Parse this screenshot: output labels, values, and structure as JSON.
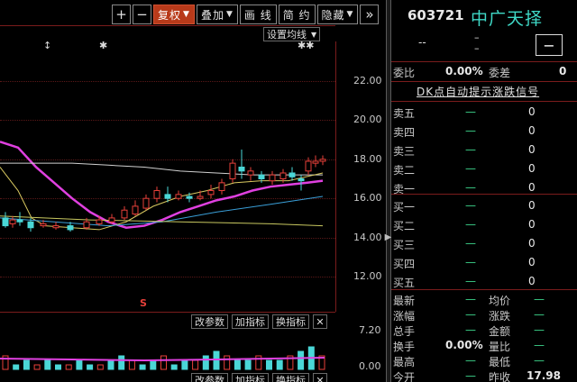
{
  "toolbar": {
    "plus": "+",
    "minus": "−",
    "fuquan": "复权",
    "diejia": "叠加",
    "huaxian": "画 线",
    "jianyue": "简 约",
    "yincang": "隐藏",
    "more": "»"
  },
  "chart": {
    "ma_setting": "设置均线",
    "price_labels": [
      "22.00",
      "20.00",
      "18.00",
      "16.00",
      "14.00",
      "12.00"
    ],
    "markers": [
      "↕",
      "✱",
      "✱✱",
      "S"
    ]
  },
  "sub_panel": {
    "buttons": [
      "改参数",
      "加指标",
      "换指标"
    ],
    "close": "✕",
    "vol_labels": [
      "7.20",
      "0.00"
    ]
  },
  "quote": {
    "code": "603721",
    "name": "中广天择",
    "dash1": "--",
    "dash2": "–\n–",
    "minus_box": "−",
    "weibi_label": "委比",
    "weibi_value": "0.00%",
    "weicha_label": "委差",
    "weicha_value": "0",
    "dk_title": "DK点自动提示涨跌信号",
    "sell": [
      {
        "label": "卖五",
        "price": "—",
        "vol": "0"
      },
      {
        "label": "卖四",
        "price": "—",
        "vol": "0"
      },
      {
        "label": "卖三",
        "price": "—",
        "vol": "0"
      },
      {
        "label": "卖二",
        "price": "—",
        "vol": "0"
      },
      {
        "label": "卖一",
        "price": "—",
        "vol": "0"
      }
    ],
    "buy": [
      {
        "label": "买一",
        "price": "—",
        "vol": "0"
      },
      {
        "label": "买二",
        "price": "—",
        "vol": "0"
      },
      {
        "label": "买三",
        "price": "—",
        "vol": "0"
      },
      {
        "label": "买四",
        "price": "—",
        "vol": "0"
      },
      {
        "label": "买五",
        "price": "—",
        "vol": "0"
      }
    ],
    "stats": [
      {
        "l1": "最新",
        "v1": "—",
        "l2": "均价",
        "v2": "—"
      },
      {
        "l1": "涨幅",
        "v1": "—",
        "l2": "涨跌",
        "v2": "—"
      },
      {
        "l1": "总手",
        "v1": "—",
        "l2": "金额",
        "v2": "—"
      },
      {
        "l1": "换手",
        "v1": "0.00%",
        "l2": "量比",
        "v2": "—"
      },
      {
        "l1": "最高",
        "v1": "—",
        "l2": "最低",
        "v2": "—"
      },
      {
        "l1": "今开",
        "v1": "—",
        "l2": "昨收",
        "v2": "17.98"
      }
    ]
  },
  "colors": {
    "up": "#e8403a",
    "down": "#4ad7d7",
    "ma_magenta": "#e040e0",
    "ma_yellow": "#d8c860",
    "ma_blue": "#3a9fd8",
    "ma_white": "#d0d0d0",
    "quote_green": "#3cd48c",
    "name_cyan": "#3fd9c7"
  }
}
